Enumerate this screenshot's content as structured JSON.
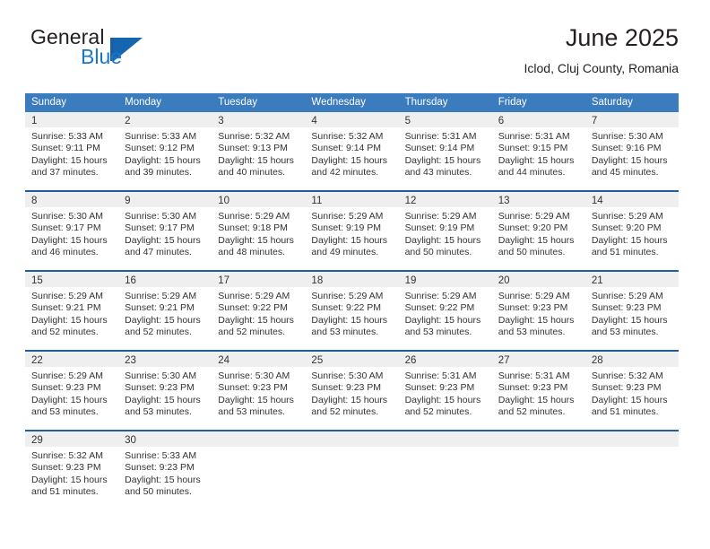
{
  "brand": {
    "name_part1": "General",
    "name_part2": "Blue",
    "mark": "flag-triangle-logo",
    "accent_color": "#1566b0"
  },
  "header": {
    "title": "June 2025",
    "subtitle": "Iclod, Cluj County, Romania"
  },
  "theme": {
    "header_row_bg": "#3a7cbe",
    "week_divider": "#1f5fa0",
    "daynum_band_bg": "#efefef",
    "text": "#333333"
  },
  "weekdays": [
    "Sunday",
    "Monday",
    "Tuesday",
    "Wednesday",
    "Thursday",
    "Friday",
    "Saturday"
  ],
  "weeks": [
    [
      {
        "day": "1",
        "sunrise": "Sunrise: 5:33 AM",
        "sunset": "Sunset: 9:11 PM",
        "daylight_line1": "Daylight: 15 hours",
        "daylight_line2": "and 37 minutes."
      },
      {
        "day": "2",
        "sunrise": "Sunrise: 5:33 AM",
        "sunset": "Sunset: 9:12 PM",
        "daylight_line1": "Daylight: 15 hours",
        "daylight_line2": "and 39 minutes."
      },
      {
        "day": "3",
        "sunrise": "Sunrise: 5:32 AM",
        "sunset": "Sunset: 9:13 PM",
        "daylight_line1": "Daylight: 15 hours",
        "daylight_line2": "and 40 minutes."
      },
      {
        "day": "4",
        "sunrise": "Sunrise: 5:32 AM",
        "sunset": "Sunset: 9:14 PM",
        "daylight_line1": "Daylight: 15 hours",
        "daylight_line2": "and 42 minutes."
      },
      {
        "day": "5",
        "sunrise": "Sunrise: 5:31 AM",
        "sunset": "Sunset: 9:14 PM",
        "daylight_line1": "Daylight: 15 hours",
        "daylight_line2": "and 43 minutes."
      },
      {
        "day": "6",
        "sunrise": "Sunrise: 5:31 AM",
        "sunset": "Sunset: 9:15 PM",
        "daylight_line1": "Daylight: 15 hours",
        "daylight_line2": "and 44 minutes."
      },
      {
        "day": "7",
        "sunrise": "Sunrise: 5:30 AM",
        "sunset": "Sunset: 9:16 PM",
        "daylight_line1": "Daylight: 15 hours",
        "daylight_line2": "and 45 minutes."
      }
    ],
    [
      {
        "day": "8",
        "sunrise": "Sunrise: 5:30 AM",
        "sunset": "Sunset: 9:17 PM",
        "daylight_line1": "Daylight: 15 hours",
        "daylight_line2": "and 46 minutes."
      },
      {
        "day": "9",
        "sunrise": "Sunrise: 5:30 AM",
        "sunset": "Sunset: 9:17 PM",
        "daylight_line1": "Daylight: 15 hours",
        "daylight_line2": "and 47 minutes."
      },
      {
        "day": "10",
        "sunrise": "Sunrise: 5:29 AM",
        "sunset": "Sunset: 9:18 PM",
        "daylight_line1": "Daylight: 15 hours",
        "daylight_line2": "and 48 minutes."
      },
      {
        "day": "11",
        "sunrise": "Sunrise: 5:29 AM",
        "sunset": "Sunset: 9:19 PM",
        "daylight_line1": "Daylight: 15 hours",
        "daylight_line2": "and 49 minutes."
      },
      {
        "day": "12",
        "sunrise": "Sunrise: 5:29 AM",
        "sunset": "Sunset: 9:19 PM",
        "daylight_line1": "Daylight: 15 hours",
        "daylight_line2": "and 50 minutes."
      },
      {
        "day": "13",
        "sunrise": "Sunrise: 5:29 AM",
        "sunset": "Sunset: 9:20 PM",
        "daylight_line1": "Daylight: 15 hours",
        "daylight_line2": "and 50 minutes."
      },
      {
        "day": "14",
        "sunrise": "Sunrise: 5:29 AM",
        "sunset": "Sunset: 9:20 PM",
        "daylight_line1": "Daylight: 15 hours",
        "daylight_line2": "and 51 minutes."
      }
    ],
    [
      {
        "day": "15",
        "sunrise": "Sunrise: 5:29 AM",
        "sunset": "Sunset: 9:21 PM",
        "daylight_line1": "Daylight: 15 hours",
        "daylight_line2": "and 52 minutes."
      },
      {
        "day": "16",
        "sunrise": "Sunrise: 5:29 AM",
        "sunset": "Sunset: 9:21 PM",
        "daylight_line1": "Daylight: 15 hours",
        "daylight_line2": "and 52 minutes."
      },
      {
        "day": "17",
        "sunrise": "Sunrise: 5:29 AM",
        "sunset": "Sunset: 9:22 PM",
        "daylight_line1": "Daylight: 15 hours",
        "daylight_line2": "and 52 minutes."
      },
      {
        "day": "18",
        "sunrise": "Sunrise: 5:29 AM",
        "sunset": "Sunset: 9:22 PM",
        "daylight_line1": "Daylight: 15 hours",
        "daylight_line2": "and 53 minutes."
      },
      {
        "day": "19",
        "sunrise": "Sunrise: 5:29 AM",
        "sunset": "Sunset: 9:22 PM",
        "daylight_line1": "Daylight: 15 hours",
        "daylight_line2": "and 53 minutes."
      },
      {
        "day": "20",
        "sunrise": "Sunrise: 5:29 AM",
        "sunset": "Sunset: 9:23 PM",
        "daylight_line1": "Daylight: 15 hours",
        "daylight_line2": "and 53 minutes."
      },
      {
        "day": "21",
        "sunrise": "Sunrise: 5:29 AM",
        "sunset": "Sunset: 9:23 PM",
        "daylight_line1": "Daylight: 15 hours",
        "daylight_line2": "and 53 minutes."
      }
    ],
    [
      {
        "day": "22",
        "sunrise": "Sunrise: 5:29 AM",
        "sunset": "Sunset: 9:23 PM",
        "daylight_line1": "Daylight: 15 hours",
        "daylight_line2": "and 53 minutes."
      },
      {
        "day": "23",
        "sunrise": "Sunrise: 5:30 AM",
        "sunset": "Sunset: 9:23 PM",
        "daylight_line1": "Daylight: 15 hours",
        "daylight_line2": "and 53 minutes."
      },
      {
        "day": "24",
        "sunrise": "Sunrise: 5:30 AM",
        "sunset": "Sunset: 9:23 PM",
        "daylight_line1": "Daylight: 15 hours",
        "daylight_line2": "and 53 minutes."
      },
      {
        "day": "25",
        "sunrise": "Sunrise: 5:30 AM",
        "sunset": "Sunset: 9:23 PM",
        "daylight_line1": "Daylight: 15 hours",
        "daylight_line2": "and 52 minutes."
      },
      {
        "day": "26",
        "sunrise": "Sunrise: 5:31 AM",
        "sunset": "Sunset: 9:23 PM",
        "daylight_line1": "Daylight: 15 hours",
        "daylight_line2": "and 52 minutes."
      },
      {
        "day": "27",
        "sunrise": "Sunrise: 5:31 AM",
        "sunset": "Sunset: 9:23 PM",
        "daylight_line1": "Daylight: 15 hours",
        "daylight_line2": "and 52 minutes."
      },
      {
        "day": "28",
        "sunrise": "Sunrise: 5:32 AM",
        "sunset": "Sunset: 9:23 PM",
        "daylight_line1": "Daylight: 15 hours",
        "daylight_line2": "and 51 minutes."
      }
    ],
    [
      {
        "day": "29",
        "sunrise": "Sunrise: 5:32 AM",
        "sunset": "Sunset: 9:23 PM",
        "daylight_line1": "Daylight: 15 hours",
        "daylight_line2": "and 51 minutes."
      },
      {
        "day": "30",
        "sunrise": "Sunrise: 5:33 AM",
        "sunset": "Sunset: 9:23 PM",
        "daylight_line1": "Daylight: 15 hours",
        "daylight_line2": "and 50 minutes."
      },
      {
        "day": "",
        "sunrise": "",
        "sunset": "",
        "daylight_line1": "",
        "daylight_line2": ""
      },
      {
        "day": "",
        "sunrise": "",
        "sunset": "",
        "daylight_line1": "",
        "daylight_line2": ""
      },
      {
        "day": "",
        "sunrise": "",
        "sunset": "",
        "daylight_line1": "",
        "daylight_line2": ""
      },
      {
        "day": "",
        "sunrise": "",
        "sunset": "",
        "daylight_line1": "",
        "daylight_line2": ""
      },
      {
        "day": "",
        "sunrise": "",
        "sunset": "",
        "daylight_line1": "",
        "daylight_line2": ""
      }
    ]
  ]
}
